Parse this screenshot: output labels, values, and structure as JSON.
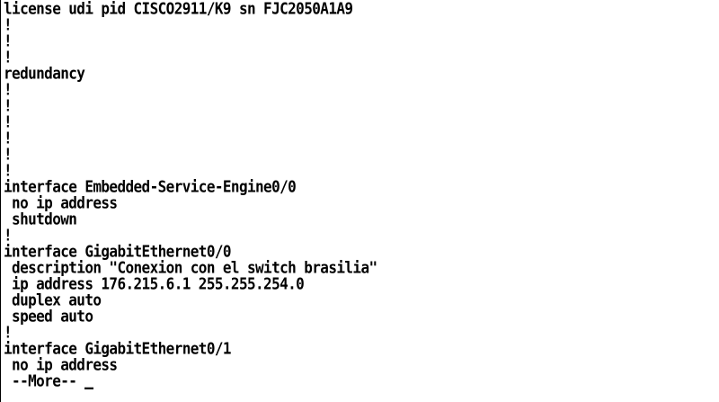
{
  "terminal": {
    "lines": [
      "license udi pid CISCO2911/K9 sn FJC2050A1A9",
      "!",
      "!",
      "!",
      "redundancy",
      "!",
      "!",
      "!",
      "!",
      "!",
      "!",
      "interface Embedded-Service-Engine0/0",
      " no ip address",
      " shutdown",
      "!",
      "interface GigabitEthernet0/0",
      " description \"Conexion con el switch brasilia\"",
      " ip address 176.215.6.1 255.255.254.0",
      " duplex auto",
      " speed auto",
      "!",
      "interface GigabitEthernet0/1",
      " no ip address"
    ],
    "more_prompt": " --More-- "
  }
}
